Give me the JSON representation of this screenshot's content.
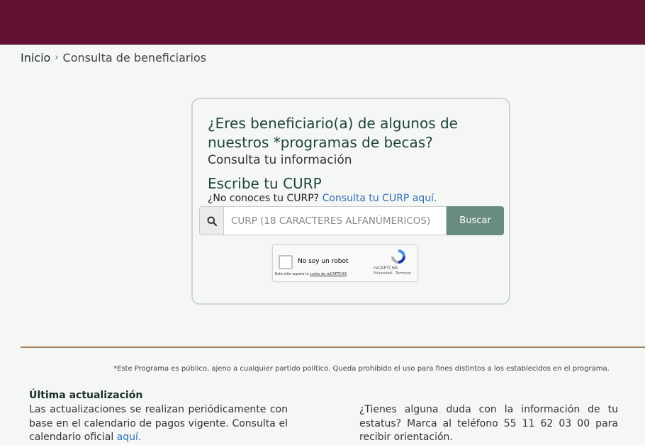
{
  "breadcrumb": {
    "home": "Inicio",
    "separator": "›",
    "current": "Consulta de beneficiarios"
  },
  "card": {
    "question": "¿Eres beneficiario(a) de algunos de nuestros *programas de becas?",
    "subtitle": "Consulta tu información",
    "curp_title": "Escribe tu CURP",
    "curp_help": "¿No conoces tu CURP?",
    "curp_link": "Consulta tu CURP aquí.",
    "search_placeholder": "CURP (18 CARACTERES ALFANÚMERICOS)",
    "search_button": "Buscar",
    "recaptcha": {
      "label": "No soy un robot",
      "brand": "reCAPTCHA",
      "terms": "Privacidad - Términos",
      "bottom_prefix": "Este sitio supera la ",
      "bottom_link": "cuota de reCAPTCHA",
      "bottom_suffix": "."
    }
  },
  "footer": {
    "disclaimer": "*Este Programa es público, ajeno a cualquier partido político. Queda prohibido el uso para fines distintos a los establecidos en el programa.",
    "update_title": "Última actualización",
    "update_text": "Las actualizaciones se realizan periódicamente con base en el calendario de pagos vigente. Consulta el calendario oficial ",
    "update_link": "aquí.",
    "help_text": "¿Tienes alguna duda con la información de tu estatus? Marca al teléfono 55 11 62 03 00 para recibir orientación."
  },
  "colors": {
    "header": "#611232",
    "accent_green": "#1e4438",
    "button": "#6a8c80",
    "divider": "#a57f5a",
    "link": "#2f6eb5"
  }
}
